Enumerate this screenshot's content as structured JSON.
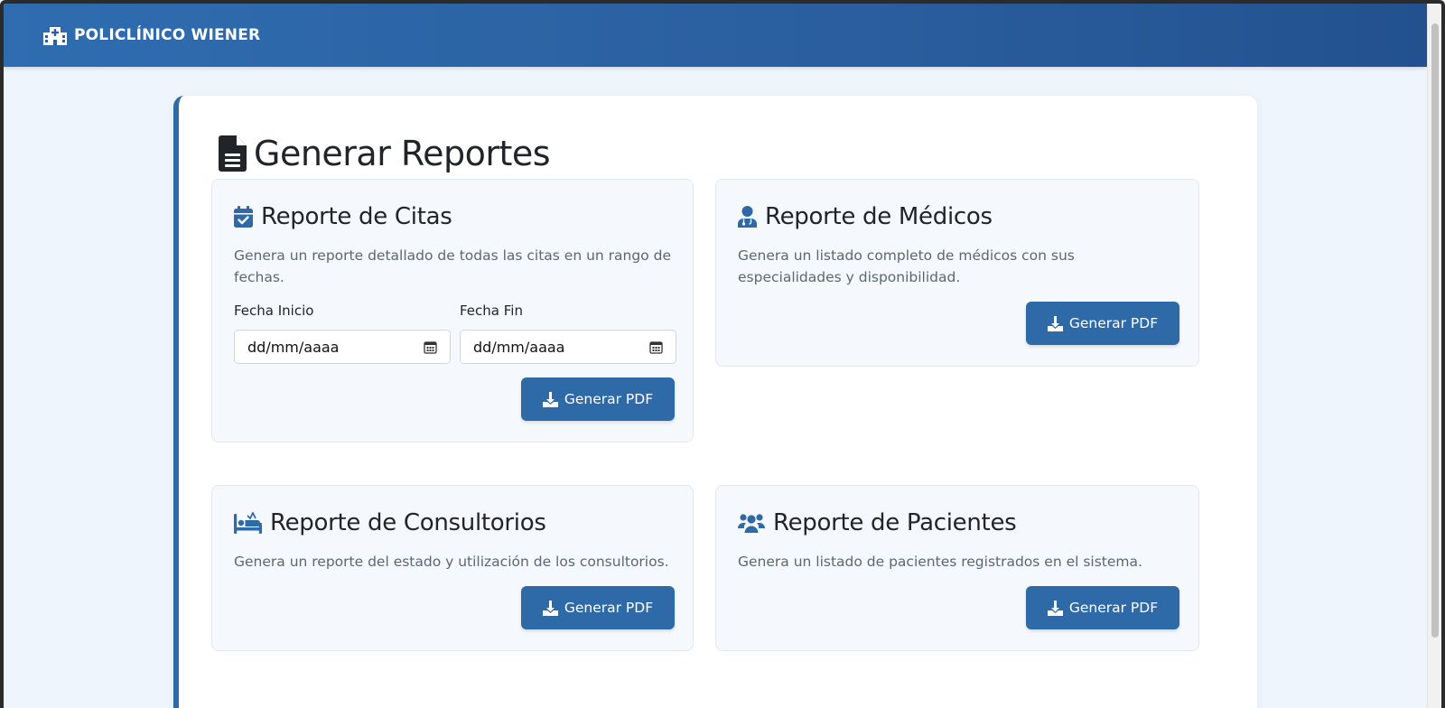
{
  "navbar": {
    "brand": "POLICLÍNICO WIENER"
  },
  "page": {
    "title": "Generar Reportes"
  },
  "reports": {
    "citas": {
      "title": "Reporte de Citas",
      "description": "Genera un reporte detallado de todas las citas en un rango de fechas.",
      "start_label": "Fecha Inicio",
      "start_value": "dd/mm/aaaa",
      "end_label": "Fecha Fin",
      "end_value": "dd/mm/aaaa",
      "button": "Generar PDF"
    },
    "medicos": {
      "title": "Reporte de Médicos",
      "description": "Genera un listado completo de médicos con sus especialidades y disponibilidad.",
      "button": "Generar PDF"
    },
    "consultorios": {
      "title": "Reporte de Consultorios",
      "description": "Genera un reporte del estado y utilización de los consultorios.",
      "button": "Generar PDF"
    },
    "pacientes": {
      "title": "Reporte de Pacientes",
      "description": "Genera un listado de pacientes registrados en el sistema.",
      "button": "Generar PDF"
    }
  },
  "icons": {
    "brand": "hospital-icon",
    "title": "file-lines-icon",
    "citas": "calendar-check-icon",
    "medicos": "user-doctor-icon",
    "consultorios": "bed-icon",
    "pacientes": "users-icon",
    "button": "download-icon",
    "date_picker": "calendar-icon"
  },
  "colors": {
    "primary": "#2f6aa8",
    "navbar": "#2a5e9e",
    "background": "#eef5fc",
    "card_bg": "#f5f8fc"
  }
}
